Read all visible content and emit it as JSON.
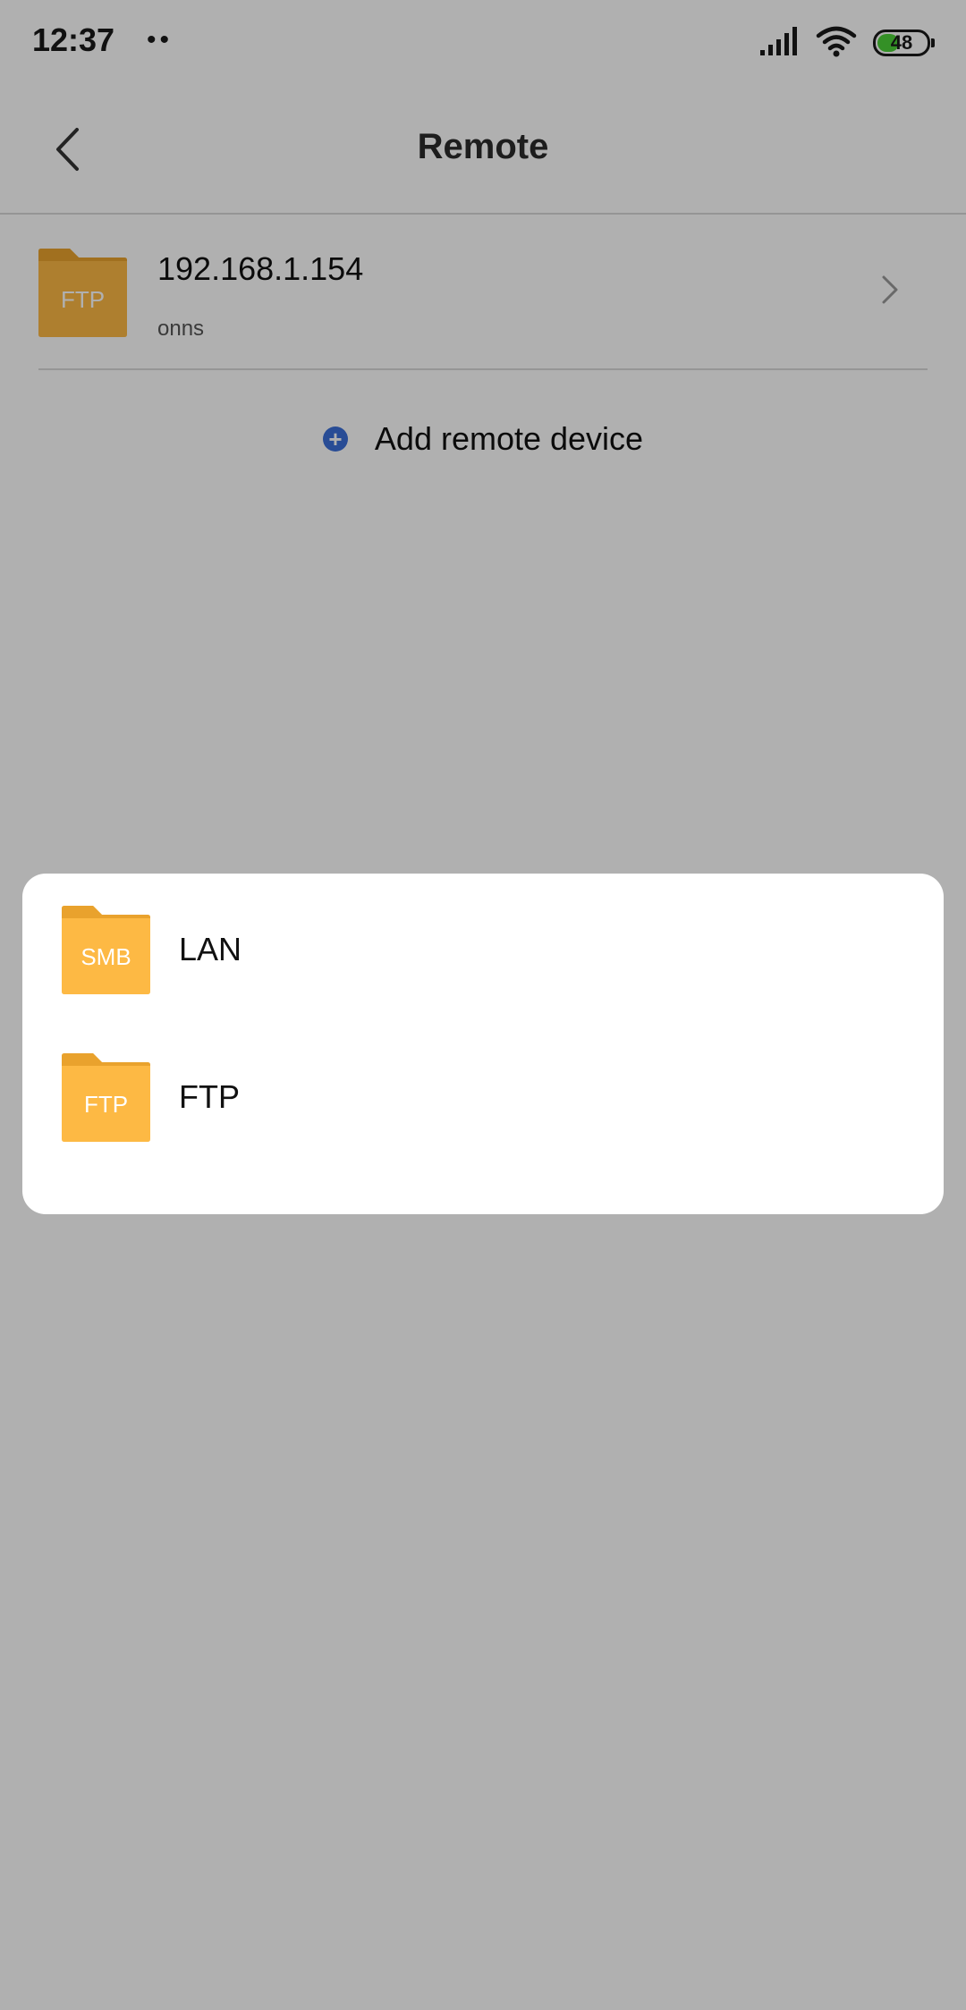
{
  "status_bar": {
    "time": "12:37",
    "dots": "••",
    "battery_level": "48",
    "battery_percent": 48
  },
  "app_bar": {
    "title": "Remote"
  },
  "device": {
    "type_label": "FTP",
    "ip": "192.168.1.154",
    "user": "onns"
  },
  "add_remote": {
    "label": "Add remote device"
  },
  "sheet": {
    "items": [
      {
        "badge": "SMB",
        "label": "LAN"
      },
      {
        "badge": "FTP",
        "label": "FTP"
      }
    ]
  },
  "colors": {
    "folder": "#fdb944",
    "folder_tab": "#e9a22d",
    "accent_blue": "#3a6fd8",
    "battery_green": "#4cd137"
  }
}
